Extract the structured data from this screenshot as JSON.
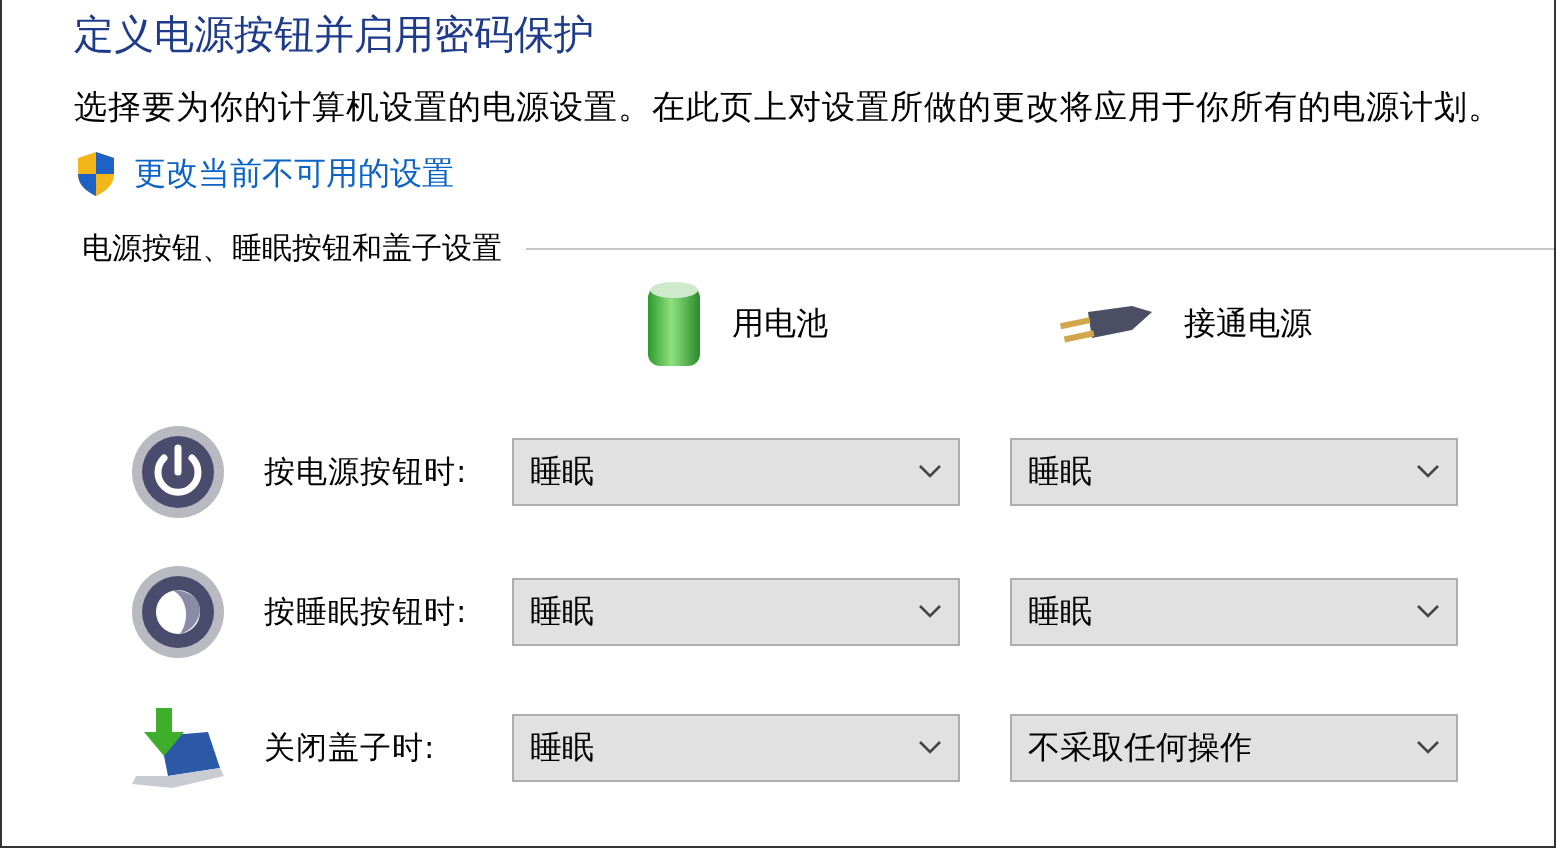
{
  "title": "定义电源按钮并启用密码保护",
  "description": "选择要为你的计算机设置的电源设置。在此页上对设置所做的更改将应用于你所有的电源计划。",
  "admin_link": "更改当前不可用的设置",
  "section": {
    "title": "电源按钮、睡眠按钮和盖子设置",
    "columns": [
      {
        "kind": "battery",
        "label": "用电池"
      },
      {
        "kind": "plug",
        "label": "接通电源"
      }
    ],
    "rows": [
      {
        "kind": "power",
        "label": "按电源按钮时:",
        "values": [
          "睡眠",
          "睡眠"
        ]
      },
      {
        "kind": "sleep",
        "label": "按睡眠按钮时:",
        "values": [
          "睡眠",
          "睡眠"
        ]
      },
      {
        "kind": "lid",
        "label": "关闭盖子时:",
        "values": [
          "睡眠",
          "不采取任何操作"
        ]
      }
    ]
  }
}
